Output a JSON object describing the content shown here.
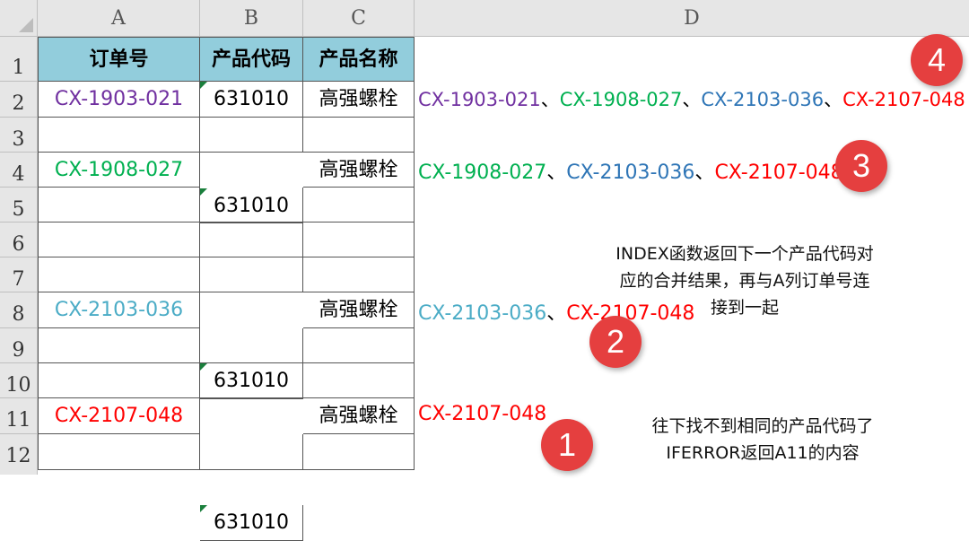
{
  "colors": {
    "purple": "#7030a0",
    "green": "#00b050",
    "blue": "#2e75b6",
    "teal": "#4bacc6",
    "red": "#ff0000",
    "header_fill": "#92cddc",
    "badge": "#e53f3f"
  },
  "columns": [
    "A",
    "B",
    "C",
    "D"
  ],
  "rows": [
    "1",
    "2",
    "3",
    "4",
    "5",
    "6",
    "7",
    "8",
    "9",
    "10",
    "11",
    "12"
  ],
  "table": {
    "headers": [
      "订单号",
      "产品代码",
      "产品名称"
    ],
    "data": [
      {
        "row": "2",
        "order": "CX-1903-021",
        "code": "631010",
        "name": "高强螺栓",
        "color": "purple"
      },
      {
        "row": "4",
        "order": "CX-1908-027",
        "code": "631010",
        "name": "高强螺栓",
        "color": "green"
      },
      {
        "row": "8",
        "order": "CX-2103-036",
        "code": "631010",
        "name": "高强螺栓",
        "color": "teal"
      },
      {
        "row": "11",
        "order": "CX-2107-048",
        "code": "631010",
        "name": "高强螺栓",
        "color": "red"
      }
    ]
  },
  "column_d": {
    "separator": "、",
    "row2": [
      "CX-1903-021",
      "CX-1908-027",
      "CX-2103-036",
      "CX-2107-048"
    ],
    "row4": [
      "CX-1908-027",
      "CX-2103-036",
      "CX-2107-048"
    ],
    "row8": [
      "CX-2103-036",
      "CX-2107-048"
    ],
    "row11": [
      "CX-2107-048"
    ]
  },
  "badges": [
    "4",
    "3",
    "2",
    "1"
  ],
  "notes": {
    "index_line1": "INDEX函数返回下一个产品代码对",
    "index_line2": "应的合并结果，再与A列订单号连",
    "index_line3": "接到一起",
    "iferror_line1": "往下找不到相同的产品代码了",
    "iferror_line2": "IFERROR返回A11的内容"
  }
}
